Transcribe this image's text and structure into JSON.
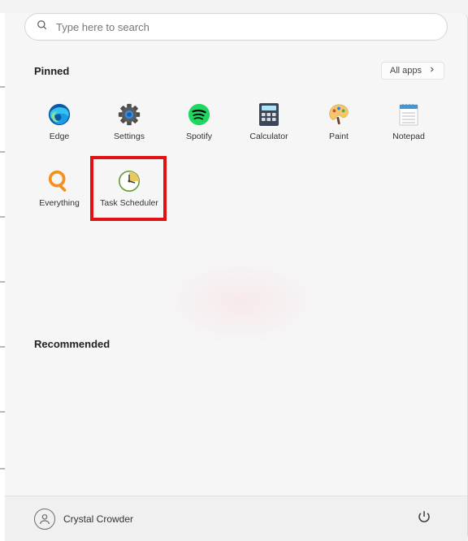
{
  "search": {
    "placeholder": "Type here to search"
  },
  "pinned": {
    "title": "Pinned",
    "all_apps_label": "All apps",
    "items": [
      {
        "label": "Edge"
      },
      {
        "label": "Settings"
      },
      {
        "label": "Spotify"
      },
      {
        "label": "Calculator"
      },
      {
        "label": "Paint"
      },
      {
        "label": "Notepad"
      },
      {
        "label": "Everything"
      },
      {
        "label": "Task Scheduler"
      }
    ]
  },
  "recommended": {
    "title": "Recommended"
  },
  "footer": {
    "username": "Crystal Crowder"
  },
  "highlight": {
    "targetIndex": 7
  }
}
